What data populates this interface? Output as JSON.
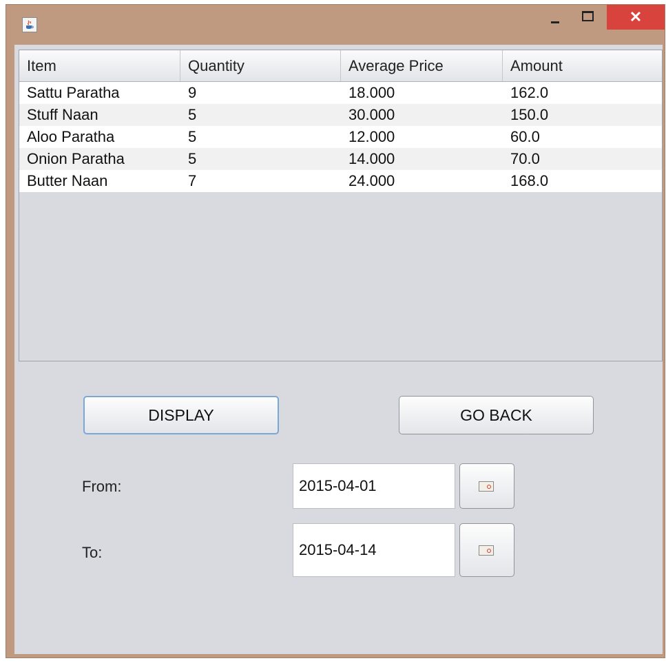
{
  "window": {
    "icon": "java-cup-icon",
    "close_glyph": "✕"
  },
  "table": {
    "columns": [
      "Item",
      "Quantity",
      "Average Price",
      "Amount"
    ],
    "rows": [
      [
        "Sattu Paratha",
        "9",
        "18.000",
        "162.0"
      ],
      [
        "Stuff Naan",
        "5",
        "30.000",
        "150.0"
      ],
      [
        "Aloo Paratha",
        "5",
        "12.000",
        "60.0"
      ],
      [
        "Onion Paratha",
        "5",
        "14.000",
        "70.0"
      ],
      [
        "Butter Naan",
        "7",
        "24.000",
        "168.0"
      ]
    ]
  },
  "buttons": {
    "display": "DISPLAY",
    "go_back": "GO BACK"
  },
  "filters": {
    "from_label": "From:",
    "from_value": "2015-04-01",
    "to_label": "To:",
    "to_value": "2015-04-14",
    "calendar_icon": "calendar-icon"
  },
  "colors": {
    "close_button": "#d9433d",
    "window_frame": "#c09a80",
    "panel_bg": "#d8dae0",
    "focus_border": "#7aa7d6"
  }
}
